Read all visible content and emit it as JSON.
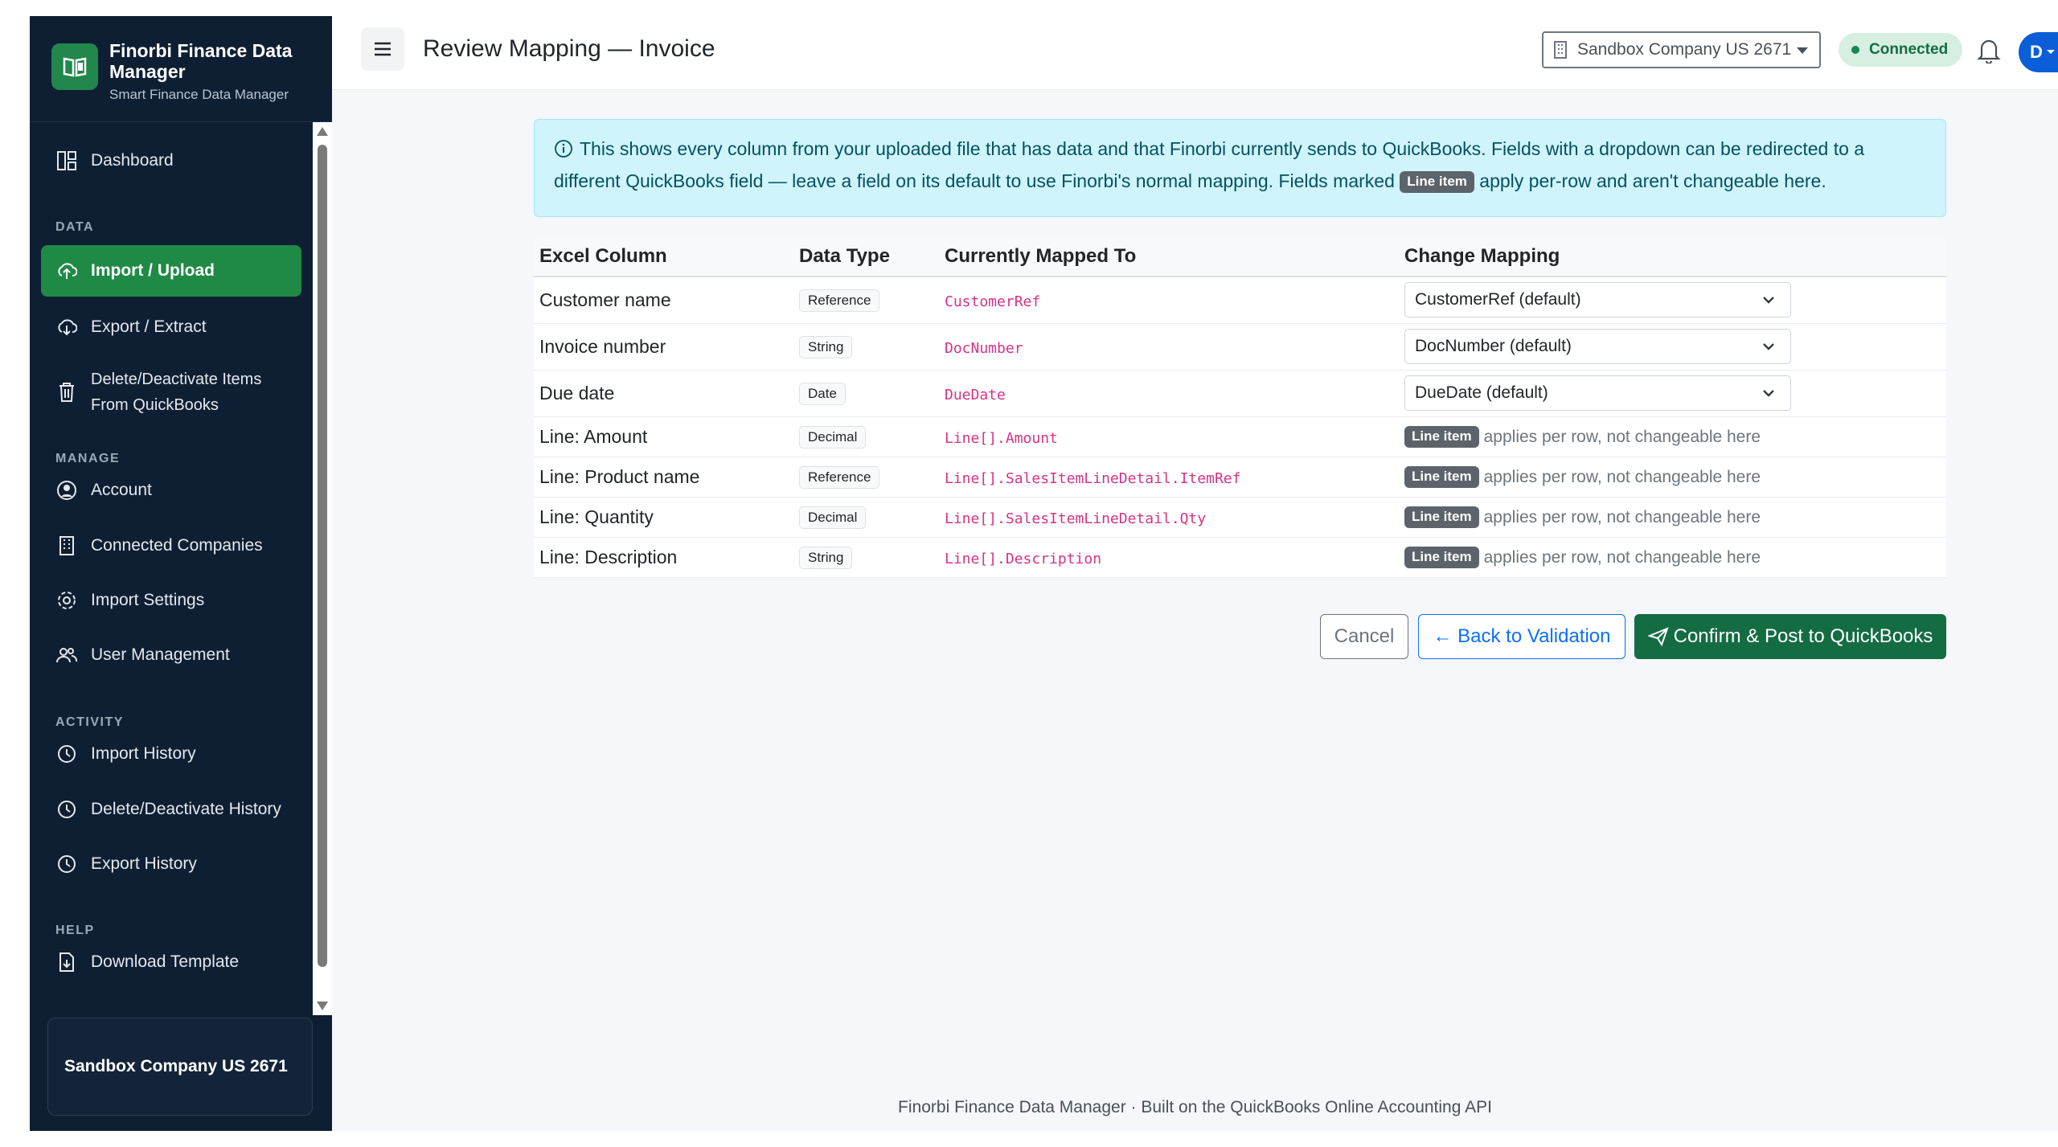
{
  "brand": {
    "title": "Finorbi Finance Data Manager",
    "subtitle": "Smart Finance Data Manager"
  },
  "sidebar": {
    "sections": {
      "data": "DATA",
      "manage": "MANAGE",
      "activity": "ACTIVITY",
      "help": "HELP"
    },
    "items": [
      {
        "label": "Dashboard",
        "icon": "dashboard-icon"
      },
      {
        "label": "Import / Upload",
        "icon": "cloud-upload-icon",
        "active": true
      },
      {
        "label": "Export / Extract",
        "icon": "cloud-download-icon"
      },
      {
        "label": "Delete/Deactivate Items From QuickBooks",
        "icon": "trash-icon"
      },
      {
        "label": "Account",
        "icon": "user-circle-icon"
      },
      {
        "label": "Connected Companies",
        "icon": "building-icon"
      },
      {
        "label": "Import Settings",
        "icon": "gear-icon"
      },
      {
        "label": "User Management",
        "icon": "users-icon"
      },
      {
        "label": "Import History",
        "icon": "clock-icon"
      },
      {
        "label": "Delete/Deactivate History",
        "icon": "clock-icon"
      },
      {
        "label": "Export History",
        "icon": "clock-icon"
      },
      {
        "label": "Download Template",
        "icon": "file-download-icon"
      }
    ],
    "company": "Sandbox Company US 2671"
  },
  "topbar": {
    "title": "Review Mapping — Invoice",
    "company_select": "Sandbox Company US 2671",
    "status": "Connected",
    "avatar": "D"
  },
  "alert": {
    "text_before": "This shows every column from your uploaded file that has data and that Finorbi currently sends to QuickBooks. Fields with a dropdown can be redirected to a different QuickBooks field — leave a field on its default to use Finorbi's normal mapping. Fields marked",
    "badge": "Line item",
    "text_after": "apply per-row and aren't changeable here."
  },
  "table": {
    "headers": [
      "Excel Column",
      "Data Type",
      "Currently Mapped To",
      "Change Mapping"
    ],
    "rows": [
      {
        "column": "Customer name",
        "type": "Reference",
        "mapped": "CustomerRef",
        "select": "CustomerRef (default)"
      },
      {
        "column": "Invoice number",
        "type": "String",
        "mapped": "DocNumber",
        "select": "DocNumber (default)"
      },
      {
        "column": "Due date",
        "type": "Date",
        "mapped": "DueDate",
        "select": "DueDate (default)"
      },
      {
        "column": "Line: Amount",
        "type": "Decimal",
        "mapped": "Line[].Amount",
        "badge": "Line item",
        "note": "applies per row, not changeable here"
      },
      {
        "column": "Line: Product name",
        "type": "Reference",
        "mapped": "Line[].SalesItemLineDetail.ItemRef",
        "badge": "Line item",
        "note": "applies per row, not changeable here"
      },
      {
        "column": "Line: Quantity",
        "type": "Decimal",
        "mapped": "Line[].SalesItemLineDetail.Qty",
        "badge": "Line item",
        "note": "applies per row, not changeable here"
      },
      {
        "column": "Line: Description",
        "type": "String",
        "mapped": "Line[].Description",
        "badge": "Line item",
        "note": "applies per row, not changeable here"
      }
    ]
  },
  "actions": {
    "cancel": "Cancel",
    "back": "← Back to Validation",
    "confirm": "Confirm & Post to QuickBooks"
  },
  "footer": "Finorbi Finance Data Manager · Built on the QuickBooks Online Accounting API"
}
